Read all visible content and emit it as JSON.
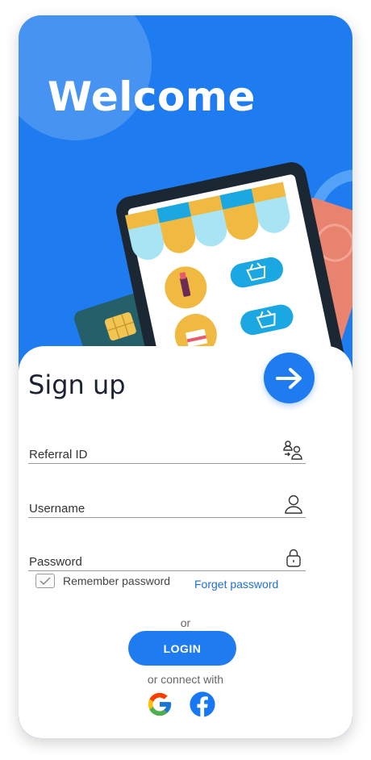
{
  "header": {
    "title": "Welcome"
  },
  "form": {
    "title": "Sign up",
    "fields": [
      {
        "label": "Referral ID",
        "icon": "referral-user-icon"
      },
      {
        "label": "Username",
        "icon": "user-icon"
      },
      {
        "label": "Password",
        "icon": "lock-icon"
      }
    ],
    "remember_label": "Remember password",
    "remember_checked": true,
    "forget_label": "Forget password",
    "or_label": "or",
    "login_label": "LOGIN",
    "connect_label": "or connect with",
    "social": [
      "google-icon",
      "facebook-icon"
    ]
  },
  "colors": {
    "primary": "#1f7cf0",
    "text": "#1a2233"
  }
}
